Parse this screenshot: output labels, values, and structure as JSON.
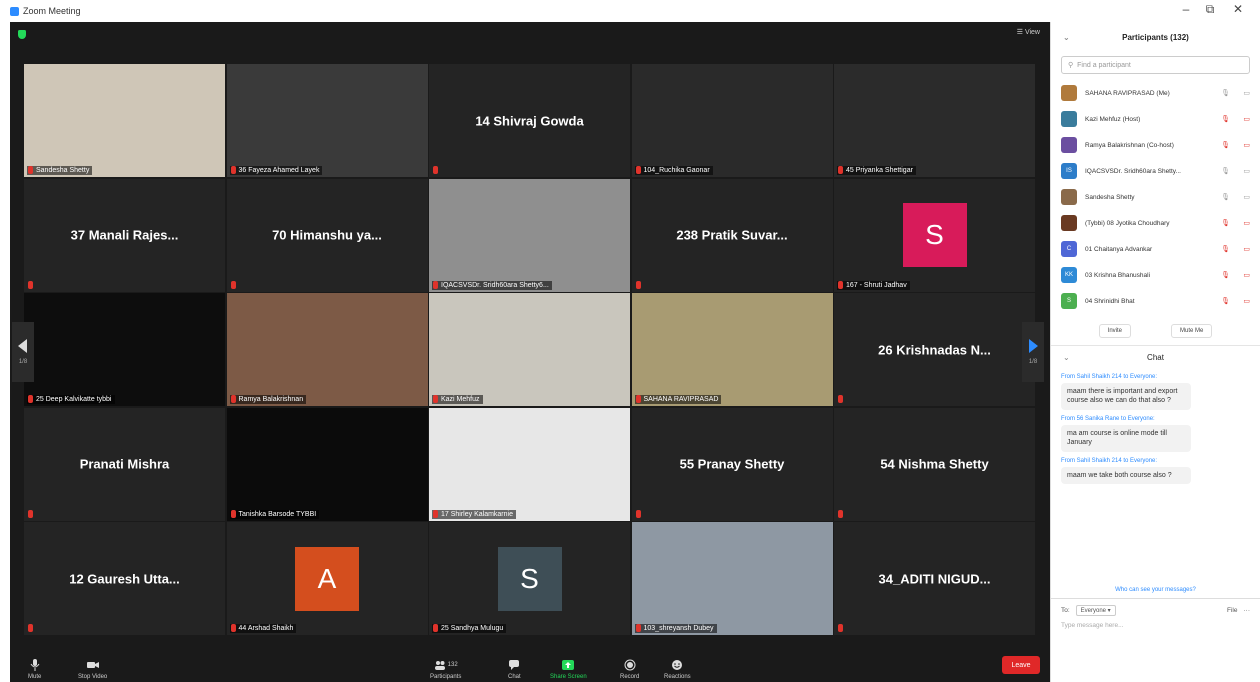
{
  "window": {
    "title": "Zoom Meeting",
    "minimize": "–",
    "maximize": "⧉",
    "close": "✕"
  },
  "topbar": {
    "view_label": "☰ View"
  },
  "tiles": [
    {
      "type": "video",
      "label": "Sandesha Shetty",
      "active": true,
      "bg": "#cfc6b7"
    },
    {
      "type": "video",
      "label": "36 Fayeza Ahamed Layek",
      "bg": "#3a3a3a"
    },
    {
      "type": "name",
      "name": "14 Shivraj Gowda",
      "label": ""
    },
    {
      "type": "video",
      "label": "104_Ruchika Gaonar",
      "bg": "#2a2a2a"
    },
    {
      "type": "video",
      "label": "45 Priyanka Shettigar",
      "bg": "#2b2b2b"
    },
    {
      "type": "name",
      "name": "37 Manali Rajes...",
      "label": ""
    },
    {
      "type": "name",
      "name": "70 Himanshu ya...",
      "label": ""
    },
    {
      "type": "video",
      "label": "IQACSVSDr. Sridh60ara Shetty6...",
      "bg": "#8f8f8f"
    },
    {
      "type": "name",
      "name": "238 Pratik Suvar...",
      "label": ""
    },
    {
      "type": "avatar",
      "letter": "S",
      "color": "#d81b5a",
      "label": "167 - Shruti Jadhav"
    },
    {
      "type": "video",
      "label": "25 Deep Kalvikatte tybbi",
      "bg": "#0d0d0d"
    },
    {
      "type": "video",
      "label": "Ramya Balakrishnan",
      "bg": "#7d5a46"
    },
    {
      "type": "video",
      "label": "Kazi Mehfuz",
      "bg": "#c9c6bd"
    },
    {
      "type": "video",
      "label": "SAHANA RAVIPRASAD",
      "bg": "#a89b72"
    },
    {
      "type": "name",
      "name": "26 Krishnadas N...",
      "label": ""
    },
    {
      "type": "name",
      "name": "Pranati Mishra",
      "label": ""
    },
    {
      "type": "video",
      "label": "Tanishka Barsode TYBBI",
      "bg": "#0b0b0b"
    },
    {
      "type": "video",
      "label": "17 Shirley Kalamkarnie",
      "bg": "#e7e7e7"
    },
    {
      "type": "name",
      "name": "55 Pranay Shetty",
      "label": ""
    },
    {
      "type": "name",
      "name": "54 Nishma Shetty",
      "label": ""
    },
    {
      "type": "name",
      "name": "12 Gauresh Utta...",
      "label": ""
    },
    {
      "type": "avatar",
      "letter": "A",
      "color": "#d44e1e",
      "label": "44 Arshad Shaikh"
    },
    {
      "type": "avatar",
      "letter": "S",
      "color": "#3e4e56",
      "label": "25 Sandhya Mulugu"
    },
    {
      "type": "video",
      "label": "103_shreyansh Dubey",
      "bg": "#8e98a3"
    },
    {
      "type": "name",
      "name": "34_ADITI NIGUD...",
      "label": ""
    }
  ],
  "nav": {
    "left_page": "1/8",
    "right_page": "1/8"
  },
  "toolbar": {
    "mute": "Mute",
    "stop_video": "Stop Video",
    "participants": "Participants",
    "participants_count": "132",
    "chat": "Chat",
    "share_screen": "Share Screen",
    "record": "Record",
    "reactions": "Reactions",
    "leave": "Leave"
  },
  "participants_panel": {
    "title": "Participants (132)",
    "search_placeholder": "Find a participant",
    "items": [
      {
        "name": "SAHANA RAVIPRASAD (Me)",
        "color": "#b07a3c",
        "mic_red": false
      },
      {
        "name": "Kazi Mehfuz (Host)",
        "color": "#3a7c9c",
        "mic_red": true
      },
      {
        "name": "Ramya Balakrishnan (Co-host)",
        "color": "#6b4ea0",
        "mic_red": true
      },
      {
        "name": "IQACSVSDr. Sridh60ara Shetty...",
        "color": "#2d7dc9",
        "mic_red": false
      },
      {
        "name": "Sandesha Shetty",
        "color": "#8a6a4a",
        "mic_red": false
      },
      {
        "name": "(Tybbi) 08 Jyotika Choudhary",
        "color": "#6a3a22",
        "mic_red": true
      },
      {
        "name": "01 Chaitanya Advankar",
        "color": "#4f67d6",
        "mic_red": true
      },
      {
        "name": "03 Krishna Bhanushali",
        "color": "#2e8ad6",
        "mic_red": true
      },
      {
        "name": "04 Shrinidhi Bhat",
        "color": "#4caf50",
        "mic_red": true
      }
    ],
    "avatar_letters": [
      "",
      "",
      "",
      "IS",
      "",
      "",
      "C",
      "KK",
      "S"
    ],
    "invite": "Invite",
    "mute_me": "Mute Me"
  },
  "chat": {
    "title": "Chat",
    "messages": [
      {
        "from": "From Sahil Shaikh 214 to Everyone:",
        "text": "maam there is important and export course also we can do that also ?"
      },
      {
        "from": "From 56 Sanika Rane to Everyone:",
        "text": "ma am course is online mode till January"
      },
      {
        "from": "From Sahil Shaikh 214 to Everyone:",
        "text": "maam we take both course also ?"
      }
    ],
    "who_can_see": "Who can see your messages?",
    "to_label": "To:",
    "to_value": "Everyone ▾",
    "file_label": "File",
    "more": "···",
    "placeholder": "Type message here..."
  }
}
